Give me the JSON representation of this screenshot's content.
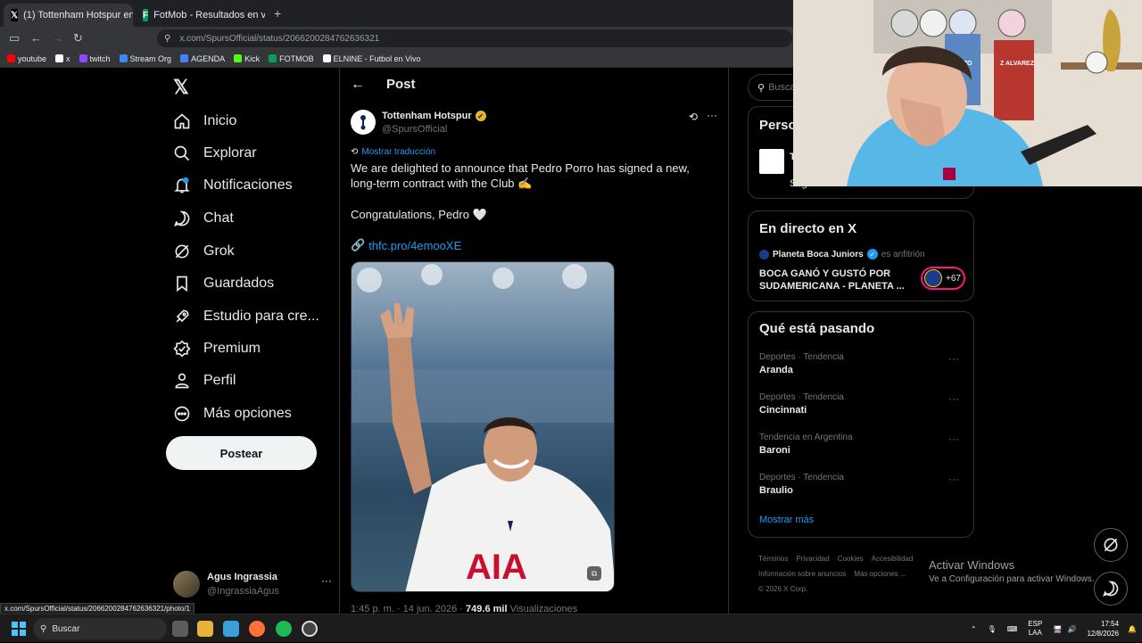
{
  "browser": {
    "tabs": [
      {
        "label": "(1) Tottenham Hotspur en X: \"W",
        "icon": "x-logo-icon",
        "active": true
      },
      {
        "label": "FotMob - Resultados en vivo de",
        "icon": "fotmob-icon",
        "active": false
      }
    ],
    "new_tab": "+",
    "url": "x.com/SpursOfficial/status/2066200284762636321",
    "bookmarks": [
      "youtube",
      "x",
      "twitch",
      "Stream Org",
      "AGENDA",
      "Kick",
      "FOTMOB",
      "ELNINE - Futbol en Vivo"
    ],
    "status_url": "x.com/SpursOfficial/status/2066200284762636321/photo/1"
  },
  "nav": {
    "items": [
      {
        "label": "Inicio",
        "icon": "home-icon"
      },
      {
        "label": "Explorar",
        "icon": "search-icon"
      },
      {
        "label": "Notificaciones",
        "icon": "bell-icon",
        "badge": "1"
      },
      {
        "label": "Chat",
        "icon": "chat-icon"
      },
      {
        "label": "Grok",
        "icon": "grok-icon"
      },
      {
        "label": "Guardados",
        "icon": "bookmark-icon"
      },
      {
        "label": "Estudio para cre...",
        "icon": "rocket-icon"
      },
      {
        "label": "Premium",
        "icon": "verified-icon"
      },
      {
        "label": "Perfil",
        "icon": "person-icon"
      },
      {
        "label": "Más opciones",
        "icon": "more-circle-icon"
      }
    ],
    "post_button": "Postear",
    "account": {
      "name": "Agus Ingrassia",
      "handle": "@IngrassiaAgus",
      "more": "···"
    }
  },
  "post": {
    "header_title": "Post",
    "author_name": "Tottenham Hotspur",
    "author_handle": "@SpursOfficial",
    "translate": "Mostrar traducción",
    "text": "We are delighted to announce that Pedro Porro has signed a new, long-term contract with the Club ✍️",
    "congrats": "Congratulations, Pedro 🤍",
    "link": "thfc.pro/4emooXE",
    "timestamp": "1:45 p. m. · 14 jun. 2026 · ",
    "views": "749.6 mil",
    "views_label": " Visualizaciones"
  },
  "right": {
    "search_placeholder": "Busca",
    "persons_title": "Perso",
    "persons_snippet": "T",
    "persons_line": "Segu",
    "live_title": "En directo en X",
    "live_host": "Planeta Boca Juniors",
    "live_host_role": "es anfitrión",
    "live_stream": "BOCA GANÓ Y GUSTÓ POR SUDAMERICANA - PLANETA ...",
    "live_count": "+67",
    "trends_title": "Qué está pasando",
    "trends": [
      {
        "category": "Deportes · Tendencia",
        "name": "Aranda"
      },
      {
        "category": "Deportes · Tendencia",
        "name": "Cincinnati"
      },
      {
        "category": "Tendencia en Argentina",
        "name": "Baroni"
      },
      {
        "category": "Deportes · Tendencia",
        "name": "Braulio"
      }
    ],
    "show_more": "Mostrar más",
    "footer": [
      "Términos",
      "Privacidad",
      "Cookies",
      "Accesibilidad",
      "Información sobre anuncios",
      "Más opciones ...",
      "© 2026 X Corp."
    ]
  },
  "windows": {
    "activate_title": "Activar Windows",
    "activate_sub": "Ve a Configuración para activar Windows.",
    "search": "Buscar",
    "lang1": "ESP",
    "lang2": "LAA",
    "time": "17:54",
    "date": "12/8/2026"
  },
  "webcam": {
    "jersey_name": "ENZO",
    "poster_name": "Z ALVAREZ"
  },
  "colors": {
    "accent": "#1d9bf0",
    "bg": "#000000",
    "post_button": "#eff3f4",
    "live_ring": "#f91880"
  }
}
